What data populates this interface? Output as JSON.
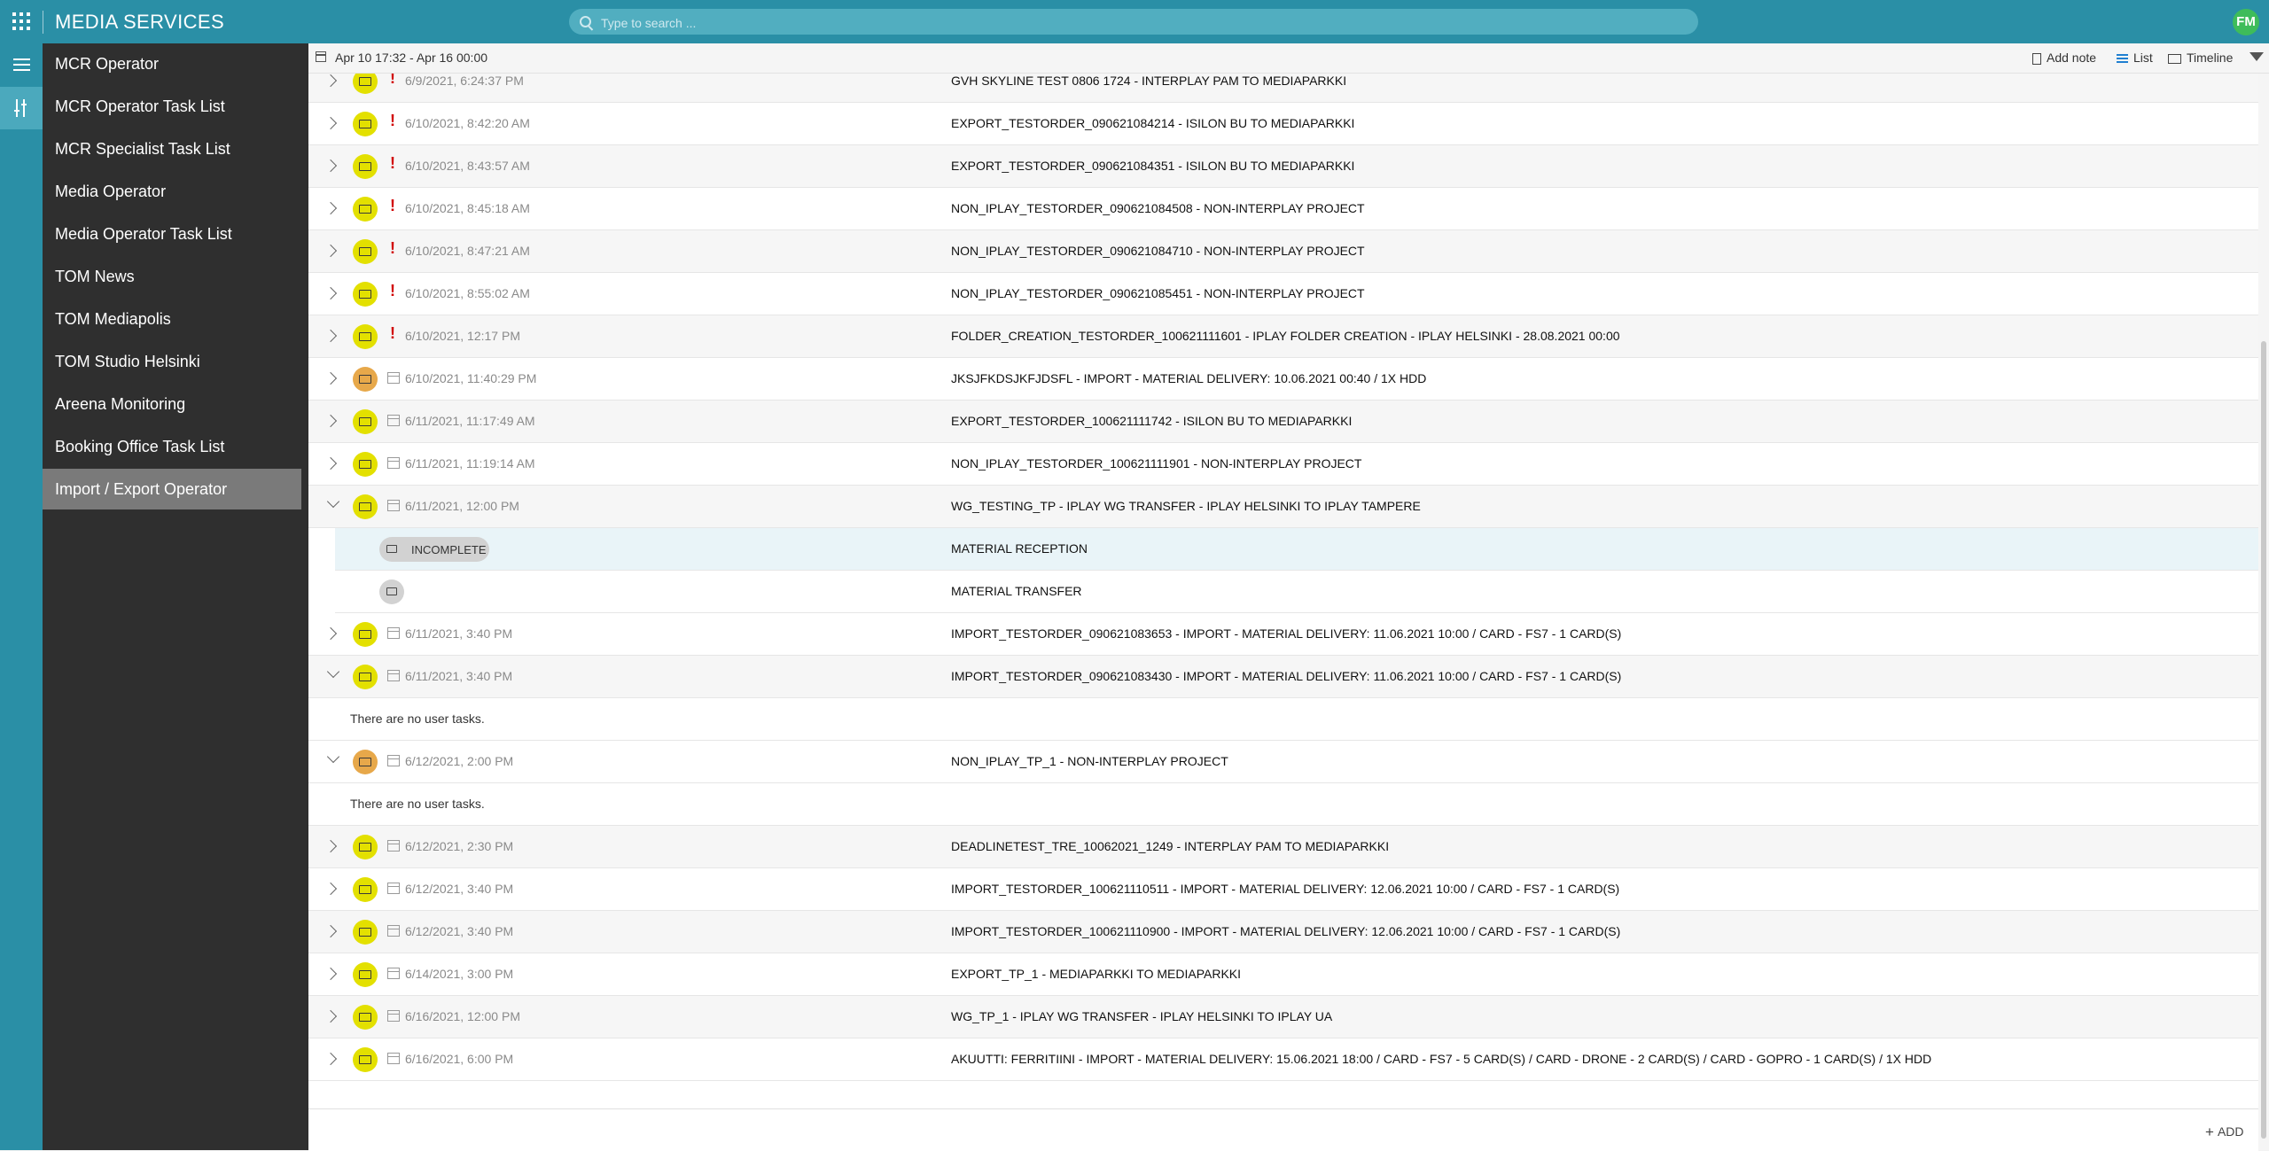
{
  "header": {
    "app_title": "MEDIA SERVICES",
    "search_placeholder": "Type to search ...",
    "avatar_initials": "FM",
    "brand_color": "#2a8fa6",
    "avatar_color": "#3ebc5a"
  },
  "rail": {
    "icons": [
      "hamburger-icon",
      "tools-icon"
    ]
  },
  "sidebar": {
    "items": [
      {
        "label": "MCR Operator"
      },
      {
        "label": "MCR Operator Task List"
      },
      {
        "label": "MCR Specialist Task List"
      },
      {
        "label": "Media Operator"
      },
      {
        "label": "Media Operator Task List"
      },
      {
        "label": "TOM News"
      },
      {
        "label": "TOM Mediapolis"
      },
      {
        "label": "TOM Studio Helsinki"
      },
      {
        "label": "Areena Monitoring"
      },
      {
        "label": "Booking Office Task List"
      },
      {
        "label": "Import / Export Operator",
        "active": true
      }
    ]
  },
  "toolbar": {
    "date_range": "Apr 10 17:32 - Apr 16 00:00",
    "add_note": "Add note",
    "list": "List",
    "timeline": "Timeline"
  },
  "rows": [
    {
      "kind": "item",
      "date": "6/9/2021, 6:24:37 PM",
      "title": "GVH SKYLINE TEST 0806 1724 - INTERPLAY PAM TO MEDIAPARKKI",
      "status": "yellow",
      "alert": true,
      "expanded": false
    },
    {
      "kind": "item",
      "date": "6/10/2021, 8:42:20 AM",
      "title": "EXPORT_TESTORDER_090621084214 - ISILON BU TO MEDIAPARKKI",
      "status": "yellow",
      "alert": true,
      "expanded": false
    },
    {
      "kind": "item",
      "date": "6/10/2021, 8:43:57 AM",
      "title": "EXPORT_TESTORDER_090621084351 - ISILON BU TO MEDIAPARKKI",
      "status": "yellow",
      "alert": true,
      "expanded": false
    },
    {
      "kind": "item",
      "date": "6/10/2021, 8:45:18 AM",
      "title": "NON_IPLAY_TESTORDER_090621084508 - NON-INTERPLAY PROJECT",
      "status": "yellow",
      "alert": true,
      "expanded": false
    },
    {
      "kind": "item",
      "date": "6/10/2021, 8:47:21 AM",
      "title": "NON_IPLAY_TESTORDER_090621084710 - NON-INTERPLAY PROJECT",
      "status": "yellow",
      "alert": true,
      "expanded": false
    },
    {
      "kind": "item",
      "date": "6/10/2021, 8:55:02 AM",
      "title": "NON_IPLAY_TESTORDER_090621085451 - NON-INTERPLAY PROJECT",
      "status": "yellow",
      "alert": true,
      "expanded": false
    },
    {
      "kind": "item",
      "date": "6/10/2021, 12:17 PM",
      "title": "FOLDER_CREATION_TESTORDER_100621111601 - IPLAY FOLDER CREATION - IPLAY HELSINKI - 28.08.2021 00:00",
      "status": "yellow",
      "alert": true,
      "expanded": false
    },
    {
      "kind": "item",
      "date": "6/10/2021, 11:40:29 PM",
      "title": "JKSJFKDSJKFJDSFL - IMPORT - MATERIAL DELIVERY: 10.06.2021 00:40 / 1X HDD",
      "status": "orange",
      "alert": false,
      "expanded": false
    },
    {
      "kind": "item",
      "date": "6/11/2021, 11:17:49 AM",
      "title": "EXPORT_TESTORDER_100621111742 - ISILON BU TO MEDIAPARKKI",
      "status": "yellow",
      "alert": false,
      "expanded": false
    },
    {
      "kind": "item",
      "date": "6/11/2021, 11:19:14 AM",
      "title": "NON_IPLAY_TESTORDER_100621111901 - NON-INTERPLAY PROJECT",
      "status": "yellow",
      "alert": false,
      "expanded": false
    },
    {
      "kind": "item",
      "date": "6/11/2021, 12:00 PM",
      "title": "WG_TESTING_TP - IPLAY WG TRANSFER - IPLAY HELSINKI TO IPLAY TAMPERE",
      "status": "yellow",
      "alert": false,
      "expanded": true
    },
    {
      "kind": "task",
      "badge": "INCOMPLETE",
      "title": "MATERIAL RECEPTION",
      "highlight": true
    },
    {
      "kind": "task",
      "badge": "",
      "title": "MATERIAL TRANSFER",
      "highlight": false
    },
    {
      "kind": "item",
      "date": "6/11/2021, 3:40 PM",
      "title": "IMPORT_TESTORDER_090621083653 - IMPORT - MATERIAL DELIVERY: 11.06.2021 10:00 / CARD - FS7 - 1 CARD(S)",
      "status": "yellow",
      "alert": false,
      "expanded": false
    },
    {
      "kind": "item",
      "date": "6/11/2021, 3:40 PM",
      "title": "IMPORT_TESTORDER_090621083430 - IMPORT - MATERIAL DELIVERY: 11.06.2021 10:00 / CARD - FS7 - 1 CARD(S)",
      "status": "yellow",
      "alert": false,
      "expanded": true
    },
    {
      "kind": "empty",
      "text": "There are no user tasks."
    },
    {
      "kind": "item",
      "date": "6/12/2021, 2:00 PM",
      "title": "NON_IPLAY_TP_1 - NON-INTERPLAY PROJECT",
      "status": "orange",
      "alert": false,
      "expanded": true
    },
    {
      "kind": "empty",
      "text": "There are no user tasks."
    },
    {
      "kind": "item",
      "date": "6/12/2021, 2:30 PM",
      "title": "DEADLINETEST_TRE_10062021_1249 - INTERPLAY PAM TO MEDIAPARKKI",
      "status": "yellow",
      "alert": false,
      "expanded": false
    },
    {
      "kind": "item",
      "date": "6/12/2021, 3:40 PM",
      "title": "IMPORT_TESTORDER_100621110511 - IMPORT - MATERIAL DELIVERY: 12.06.2021 10:00 / CARD - FS7 - 1 CARD(S)",
      "status": "yellow",
      "alert": false,
      "expanded": false
    },
    {
      "kind": "item",
      "date": "6/12/2021, 3:40 PM",
      "title": "IMPORT_TESTORDER_100621110900 - IMPORT - MATERIAL DELIVERY: 12.06.2021 10:00 / CARD - FS7 - 1 CARD(S)",
      "status": "yellow",
      "alert": false,
      "expanded": false
    },
    {
      "kind": "item",
      "date": "6/14/2021, 3:00 PM",
      "title": "EXPORT_TP_1 - MEDIAPARKKI TO MEDIAPARKKI",
      "status": "yellow",
      "alert": false,
      "expanded": false
    },
    {
      "kind": "item",
      "date": "6/16/2021, 12:00 PM",
      "title": "WG_TP_1 - IPLAY WG TRANSFER - IPLAY HELSINKI TO IPLAY UA",
      "status": "yellow",
      "alert": false,
      "expanded": false
    },
    {
      "kind": "item",
      "date": "6/16/2021, 6:00 PM",
      "title": "AKUUTTI: FERRITIINI - IMPORT - MATERIAL DELIVERY: 15.06.2021 18:00 / CARD - FS7 - 5 CARD(S) / CARD - DRONE - 2 CARD(S) / CARD - GOPRO - 1 CARD(S) / 1X HDD",
      "status": "yellow",
      "alert": false,
      "expanded": false
    }
  ],
  "footer": {
    "add_label": "ADD"
  }
}
